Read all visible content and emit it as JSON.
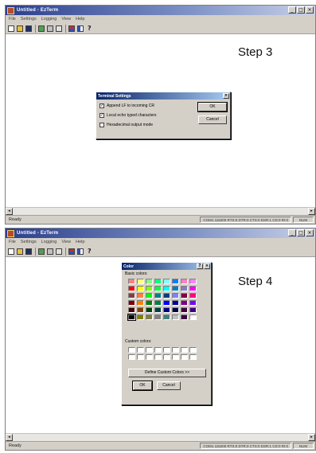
{
  "app": {
    "title": "Untitled - EzTerm",
    "menu": [
      "File",
      "Settings",
      "Logging",
      "View",
      "Help"
    ],
    "toolbar_icons": [
      "new-file-icon",
      "open-folder-icon",
      "save-icon",
      "connect-icon",
      "settings-icon",
      "log-icon",
      "color-icon",
      "view-icon",
      "help-icon"
    ],
    "help_glyph": "?",
    "window_buttons": [
      "_",
      "□",
      "×"
    ],
    "status": {
      "ready": "Ready",
      "port": "COM1 115200 RTS:0 DTR:0 CTS:0 DSR:1 CD:0 RI:0",
      "num": "NUM"
    }
  },
  "step3": {
    "label": "Step 3",
    "dialog": {
      "title": "Terminal Settings",
      "close_glyph": "×",
      "options": [
        {
          "label": "Append LF to incoming CR",
          "checked": true
        },
        {
          "label": "Local echo typed characters",
          "checked": true
        },
        {
          "label": "Hexadecimal output mode",
          "checked": false
        }
      ],
      "ok_label": "OK",
      "cancel_label": "Cancel"
    }
  },
  "step4": {
    "label": "Step 4",
    "dialog": {
      "title": "Color",
      "help_glyph": "?",
      "close_glyph": "×",
      "basic_label": "Basic colors:",
      "custom_label": "Custom colors:",
      "define_label": "Define Custom Colors >>",
      "ok_label": "OK",
      "cancel_label": "Cancel",
      "basic_colors": [
        "#ff8080",
        "#ffff80",
        "#80ff80",
        "#00ff80",
        "#80ffff",
        "#0080ff",
        "#ff80c0",
        "#ff80ff",
        "#ff0000",
        "#ffff00",
        "#80ff00",
        "#00ff40",
        "#00ffff",
        "#0080c0",
        "#8080c0",
        "#ff00ff",
        "#804040",
        "#ff8040",
        "#00ff00",
        "#008080",
        "#004080",
        "#8080ff",
        "#800040",
        "#ff0080",
        "#800000",
        "#ff8000",
        "#008000",
        "#008040",
        "#0000ff",
        "#0000a0",
        "#800080",
        "#8000ff",
        "#400000",
        "#804000",
        "#004000",
        "#004040",
        "#000080",
        "#000040",
        "#400040",
        "#400080",
        "#000000",
        "#808000",
        "#808040",
        "#808080",
        "#408080",
        "#c0c0c0",
        "#400040",
        "#ffffff"
      ],
      "selected_index": 40,
      "custom_colors": [
        "#ffffff",
        "#ffffff",
        "#ffffff",
        "#ffffff",
        "#ffffff",
        "#ffffff",
        "#ffffff",
        "#ffffff",
        "#ffffff",
        "#ffffff",
        "#ffffff",
        "#ffffff",
        "#ffffff",
        "#ffffff",
        "#ffffff",
        "#ffffff"
      ]
    }
  }
}
